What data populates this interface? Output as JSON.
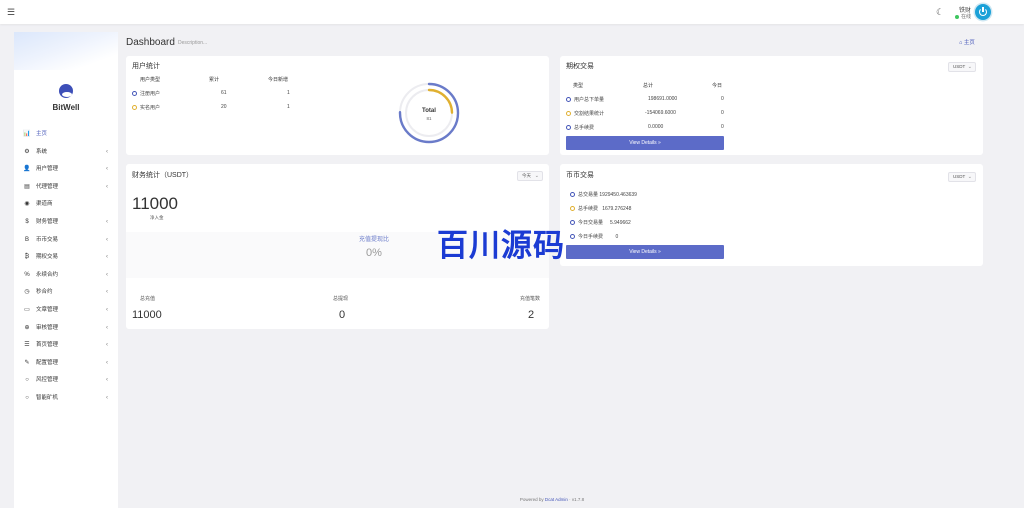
{
  "topbar": {
    "menu_icon": "hamburger-icon",
    "theme_icon": "moon-icon",
    "user_name": "铁财",
    "user_status": "在线"
  },
  "sidebar": {
    "brand": "BitWell",
    "items": [
      {
        "label": "主页",
        "icon": "chart-icon",
        "active": true
      },
      {
        "label": "系统",
        "icon": "gear-icon"
      },
      {
        "label": "用户管理",
        "icon": "user-icon"
      },
      {
        "label": "代理管理",
        "icon": "id-card-icon"
      },
      {
        "label": "渠道商",
        "icon": "user-circle-icon"
      },
      {
        "label": "财务管理",
        "icon": "dollar-icon"
      },
      {
        "label": "币币交易",
        "icon": "bitcoin-icon"
      },
      {
        "label": "期权交易",
        "icon": "coin-icon"
      },
      {
        "label": "永续合约",
        "icon": "link-icon"
      },
      {
        "label": "秒合约",
        "icon": "clock-icon"
      },
      {
        "label": "文章管理",
        "icon": "keyboard-icon"
      },
      {
        "label": "审核管理",
        "icon": "crosshair-icon"
      },
      {
        "label": "首页管理",
        "icon": "list-icon"
      },
      {
        "label": "配置管理",
        "icon": "wrench-icon"
      },
      {
        "label": "风控管理",
        "icon": "circle-icon"
      },
      {
        "label": "智能矿机",
        "icon": "circle-icon"
      }
    ]
  },
  "page": {
    "title": "Dashboard",
    "description": "Description...",
    "breadcrumb": "主页"
  },
  "user_stats": {
    "title": "用户统计",
    "headers": [
      "用户类型",
      "累计",
      "今日新增"
    ],
    "rows": [
      {
        "type": "注册用户",
        "total": "61",
        "today": "1"
      },
      {
        "type": "实名用户",
        "total": "20",
        "today": "1"
      }
    ],
    "donut_label": "Total",
    "donut_value": "81"
  },
  "options_trading": {
    "title": "期权交易",
    "currency": "USDT",
    "headers": [
      "类型",
      "总计",
      "今日"
    ],
    "rows": [
      {
        "type": "用户总下单量",
        "total": "198691.0000",
        "today": "0"
      },
      {
        "type": "交割结果统计",
        "total": "-154069.6000",
        "today": "0"
      },
      {
        "type": "总手续费",
        "total": "0.0000",
        "today": "0"
      }
    ],
    "button": "View Details »"
  },
  "finance": {
    "title": "财务统计（USDT）",
    "period": "今天",
    "big_value": "11000",
    "big_label": "净入金",
    "ratio_label": "充值提现比",
    "ratio_value": "0%",
    "footer": [
      {
        "label": "总充值",
        "value": "11000"
      },
      {
        "label": "总提现",
        "value": "0"
      },
      {
        "label": "充值笔数",
        "value": "2"
      }
    ]
  },
  "spot_trading": {
    "title": "币币交易",
    "currency": "USDT",
    "rows": [
      {
        "label": "总交易量",
        "value": "1929450.463639"
      },
      {
        "label": "总手续费",
        "value": "1679.276248"
      },
      {
        "label": "今日交易量",
        "value": "5.949662"
      },
      {
        "label": "今日手续费",
        "value": "0"
      }
    ],
    "button": "View Details »"
  },
  "watermark": "百川源码",
  "footer": {
    "prefix": "Powered by",
    "link": "Dcat Admin",
    "version": "v1.7.8"
  },
  "colors": {
    "accent": "#4355b8",
    "button": "#5c6bc8",
    "donut_blue": "#6a7bc9",
    "donut_yellow": "#e0b030",
    "online": "#3ec65f"
  }
}
